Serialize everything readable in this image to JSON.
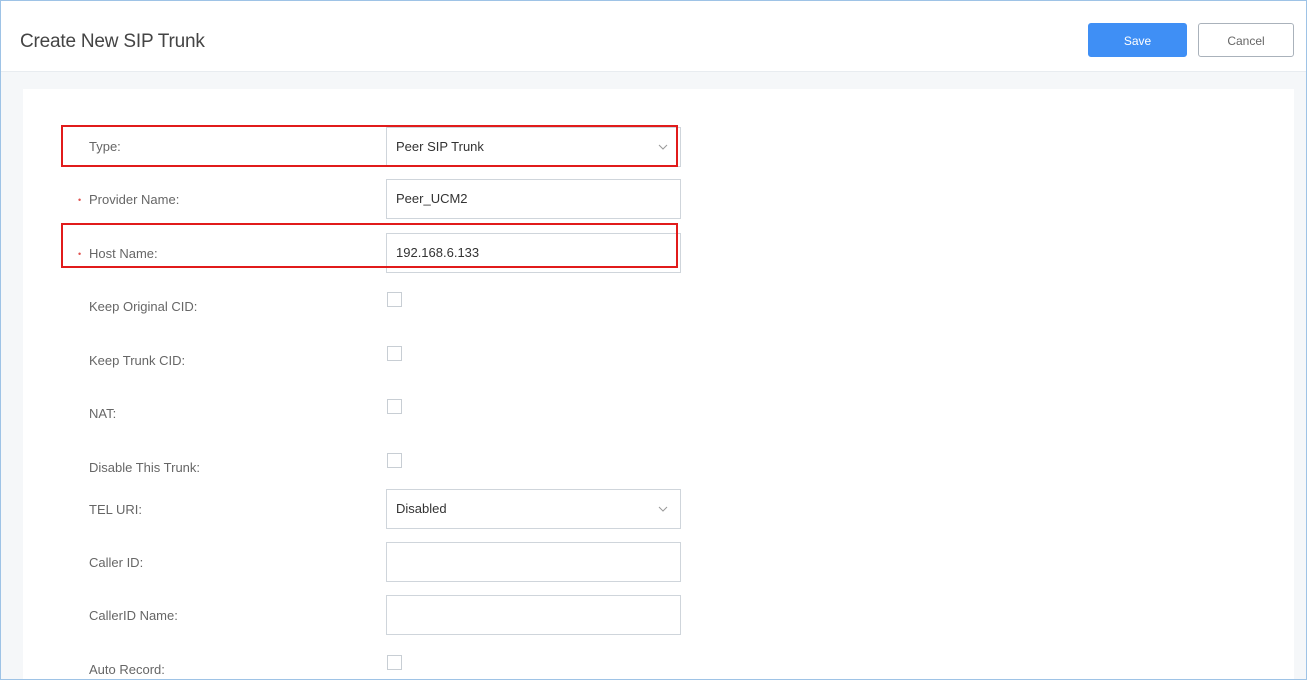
{
  "header": {
    "title": "Create New SIP Trunk",
    "save_label": "Save",
    "cancel_label": "Cancel"
  },
  "form": {
    "type": {
      "label": "Type:",
      "value": "Peer SIP Trunk"
    },
    "provider_name": {
      "label": "Provider Name:",
      "value": "Peer_UCM2",
      "required_mark": "•"
    },
    "host_name": {
      "label": "Host Name:",
      "value": "192.168.6.133",
      "required_mark": "•"
    },
    "keep_original_cid": {
      "label": "Keep Original CID:",
      "checked": false
    },
    "keep_trunk_cid": {
      "label": "Keep Trunk CID:",
      "checked": false
    },
    "nat": {
      "label": "NAT:",
      "checked": false
    },
    "disable_trunk": {
      "label": "Disable This Trunk:",
      "checked": false
    },
    "tel_uri": {
      "label": "TEL URI:",
      "value": "Disabled"
    },
    "caller_id": {
      "label": "Caller ID:",
      "value": ""
    },
    "caller_id_name": {
      "label": "CallerID Name:",
      "value": ""
    },
    "auto_record": {
      "label": "Auto Record:",
      "checked": false
    }
  },
  "colors": {
    "accent": "#3f8ff5",
    "highlight": "#e11b1b",
    "required": "#e0524f"
  },
  "icons": {
    "select_arrow": "chevron-down-icon"
  }
}
